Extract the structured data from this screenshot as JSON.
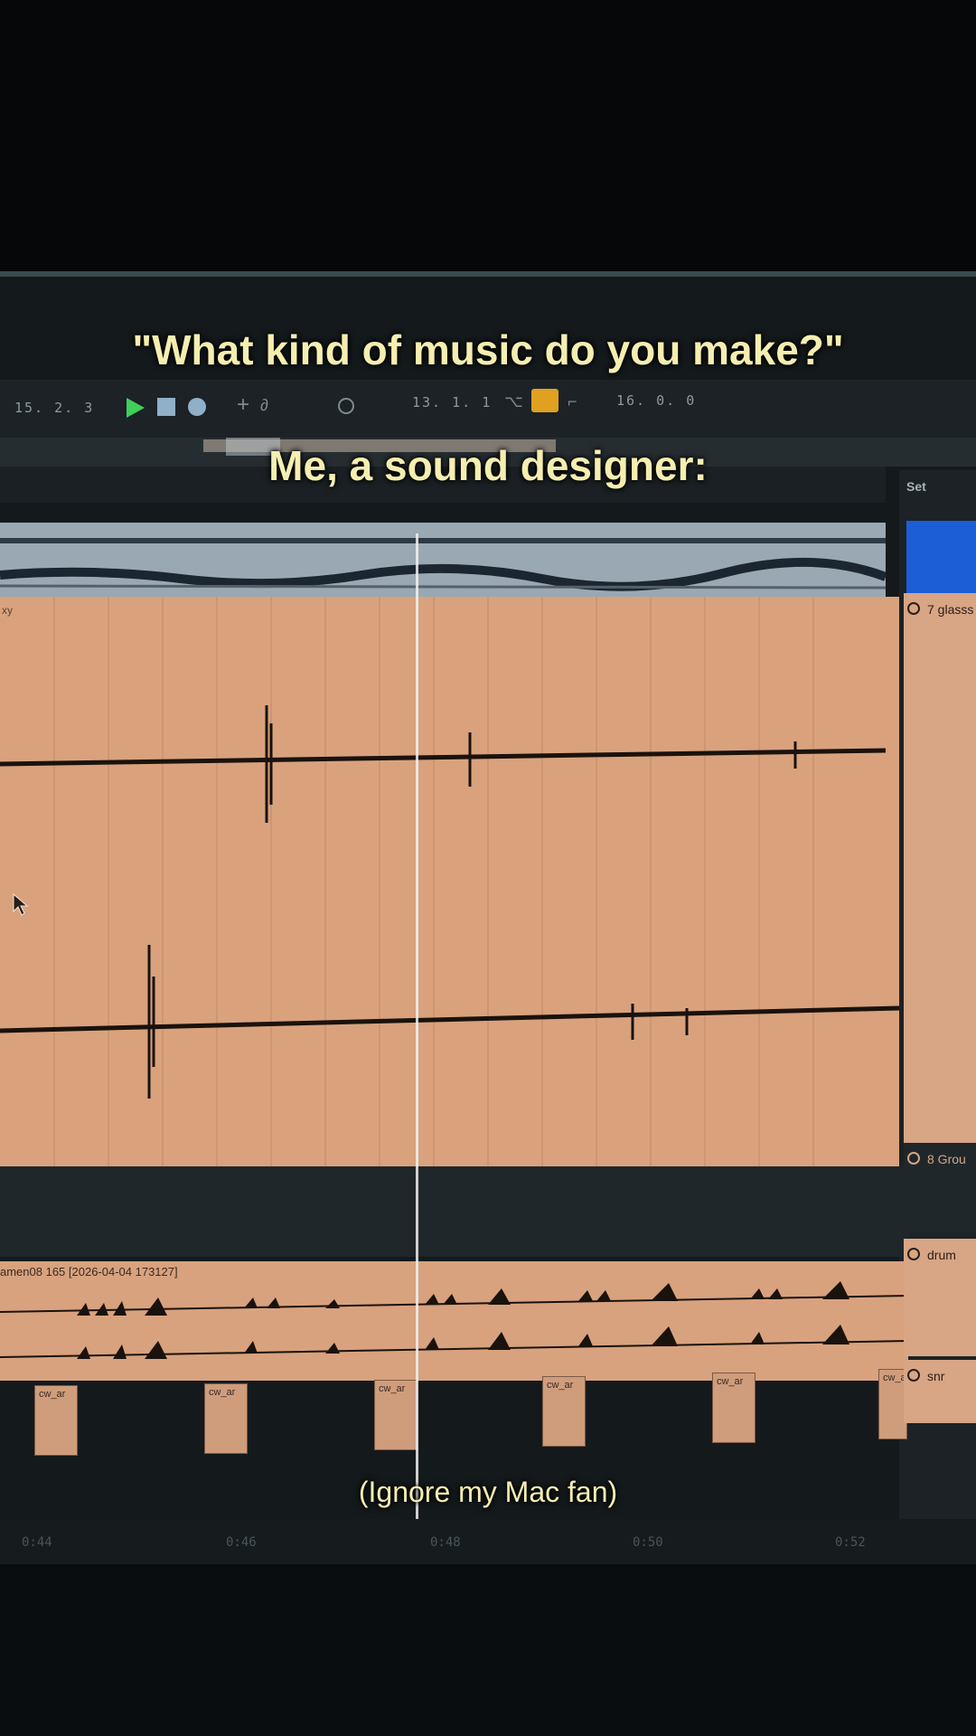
{
  "captions": {
    "question": "\"What kind of music do you make?\"",
    "answer": "Me, a sound designer:",
    "note": "(Ignore my Mac fan)"
  },
  "transport": {
    "position": "15. 2. 3",
    "loop_start": "13. 1. 1",
    "loop_length": "16. 0. 0",
    "play_icon": "play-icon",
    "stop_icon": "stop-icon",
    "record_icon": "record-icon"
  },
  "set_panel": {
    "label": "Set"
  },
  "clips": {
    "drum_clip_label": "amen08  165 [2026-04-04 173127]",
    "small_clip_label": "cw_ar",
    "big_clip_label": "xy"
  },
  "tracks": [
    {
      "label": "7 glasss"
    },
    {
      "label": "8 Grou"
    },
    {
      "label": "drum"
    },
    {
      "label": "snr"
    }
  ],
  "timeline": {
    "labels": [
      "0:44",
      "0:46",
      "0:48",
      "0:50",
      "0:52"
    ]
  },
  "colors": {
    "caption": "#f5eeb0",
    "clip_orange": "#d9a27d",
    "clip_blue": "#9aa8b4",
    "set_blue": "#1c5ed6",
    "accent_yellow": "#e0a020",
    "play_green": "#3fcf5a"
  }
}
